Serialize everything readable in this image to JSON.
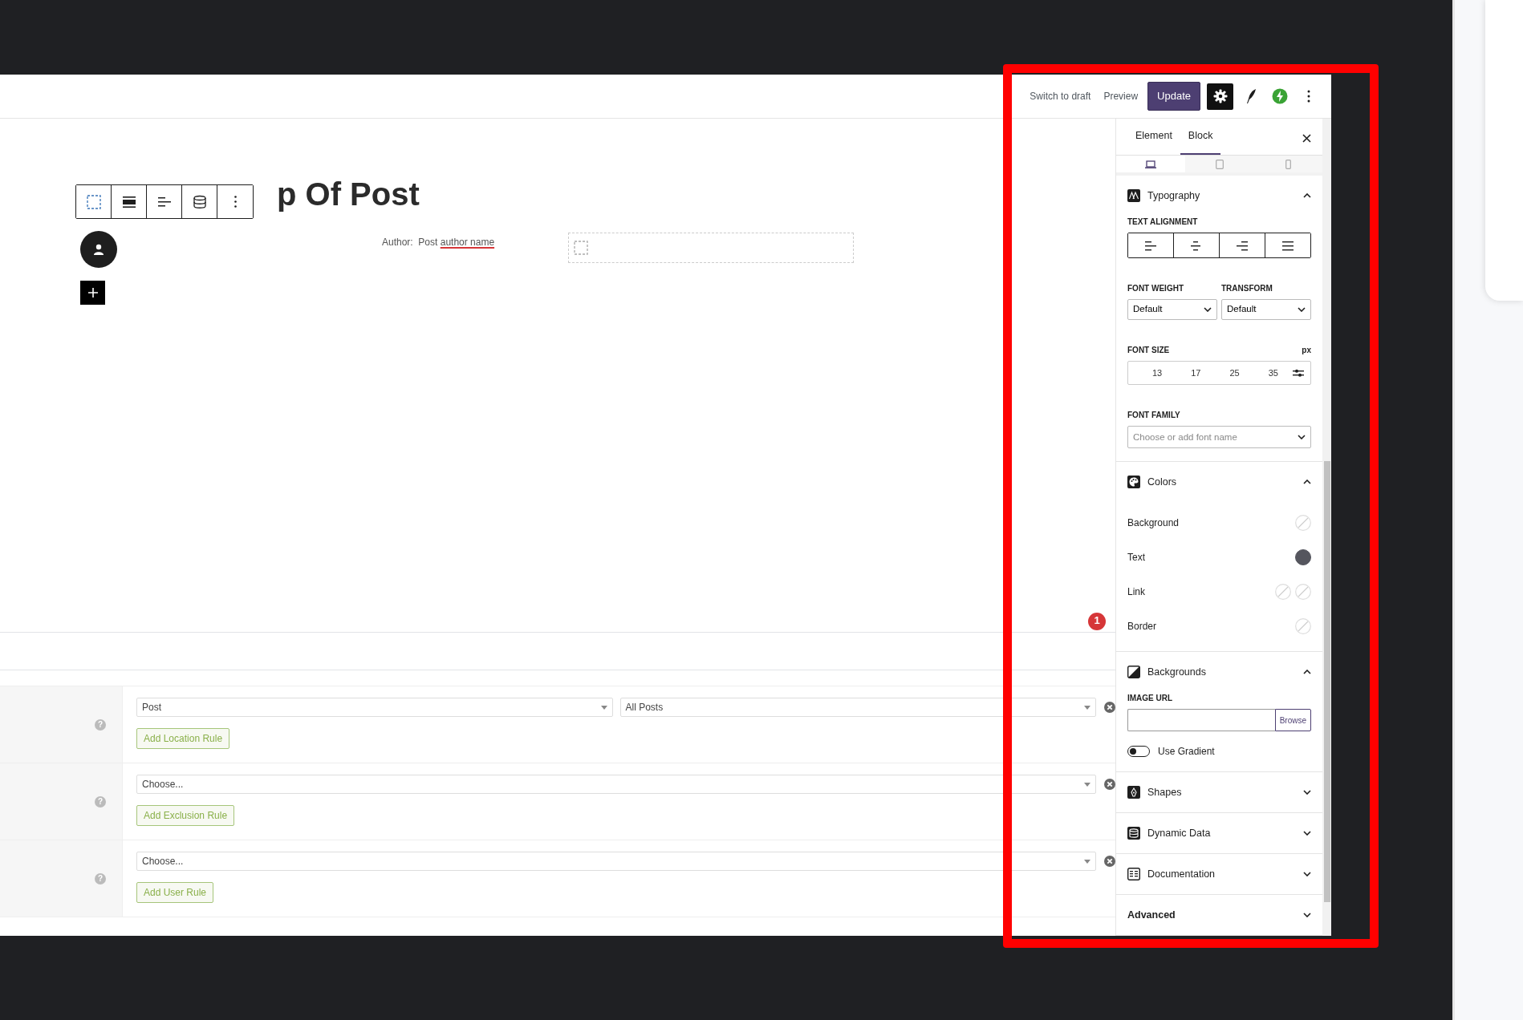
{
  "topbar": {
    "buttons": [
      {
        "label": "Switch to draft",
        "kind": "link"
      },
      {
        "label": "Preview",
        "kind": "link"
      },
      {
        "label": "Update",
        "kind": "primary"
      }
    ],
    "tools": [
      {
        "kind": "settings",
        "selected": true
      },
      {
        "kind": "feather",
        "selected": false
      },
      {
        "kind": "bolt",
        "selected": false
      },
      {
        "kind": "more",
        "selected": false
      }
    ]
  },
  "canvas": {
    "title": "p Of Post",
    "author_label": "Author:",
    "author_text": "Post",
    "author_flagged": "author name",
    "notification_badge": "1"
  },
  "rules": [
    {
      "help": "?",
      "selects": [
        "Post",
        "All Posts"
      ],
      "button": "Add Location Rule"
    },
    {
      "help": "?",
      "selects": [
        "Choose..."
      ],
      "button": "Add Exclusion Rule"
    },
    {
      "help": "?",
      "selects": [
        "Choose..."
      ],
      "button": "Add User Rule"
    }
  ],
  "sidebar": {
    "tabs": [
      {
        "label": "Element",
        "selected": false
      },
      {
        "label": "Block",
        "selected": true
      }
    ],
    "devices": [
      {
        "kind": "desktop",
        "selected": true
      },
      {
        "kind": "tablet",
        "selected": false
      },
      {
        "kind": "mobile",
        "selected": false
      }
    ],
    "panels": [
      {
        "kind": "typography",
        "title": "Typography",
        "expanded": true,
        "alignment_label": "TEXT ALIGNMENT",
        "alignments": [
          {
            "kind": "left"
          },
          {
            "kind": "center"
          },
          {
            "kind": "right"
          },
          {
            "kind": "justify"
          }
        ],
        "weight": {
          "label": "FONT WEIGHT",
          "value": "Default"
        },
        "transform": {
          "label": "TRANSFORM",
          "value": "Default"
        },
        "size": {
          "label": "FONT SIZE",
          "unit": "px",
          "presets": [
            "13",
            "17",
            "25",
            "35"
          ]
        },
        "family": {
          "label": "FONT FAMILY",
          "placeholder": "Choose or add font name"
        }
      },
      {
        "kind": "colors",
        "title": "Colors",
        "expanded": true,
        "rows": [
          {
            "label": "Background",
            "swatches": [
              {
                "set": false
              }
            ]
          },
          {
            "label": "Text",
            "swatches": [
              {
                "set": true,
                "color": "#55565e"
              }
            ]
          },
          {
            "label": "Link",
            "swatches": [
              {
                "set": false
              },
              {
                "set": false
              }
            ]
          },
          {
            "label": "Border",
            "swatches": [
              {
                "set": false
              }
            ]
          }
        ]
      },
      {
        "kind": "backgrounds",
        "title": "Backgrounds",
        "expanded": true,
        "url_label": "IMAGE URL",
        "browse": "Browse",
        "gradient": {
          "label": "Use Gradient",
          "on": false
        }
      },
      {
        "kind": "shapes",
        "title": "Shapes",
        "expanded": false
      },
      {
        "kind": "dynamic",
        "title": "Dynamic Data",
        "expanded": false
      },
      {
        "kind": "documentation",
        "title": "Documentation",
        "expanded": false
      },
      {
        "kind": "advanced",
        "title": "Advanced",
        "expanded": false
      }
    ]
  }
}
